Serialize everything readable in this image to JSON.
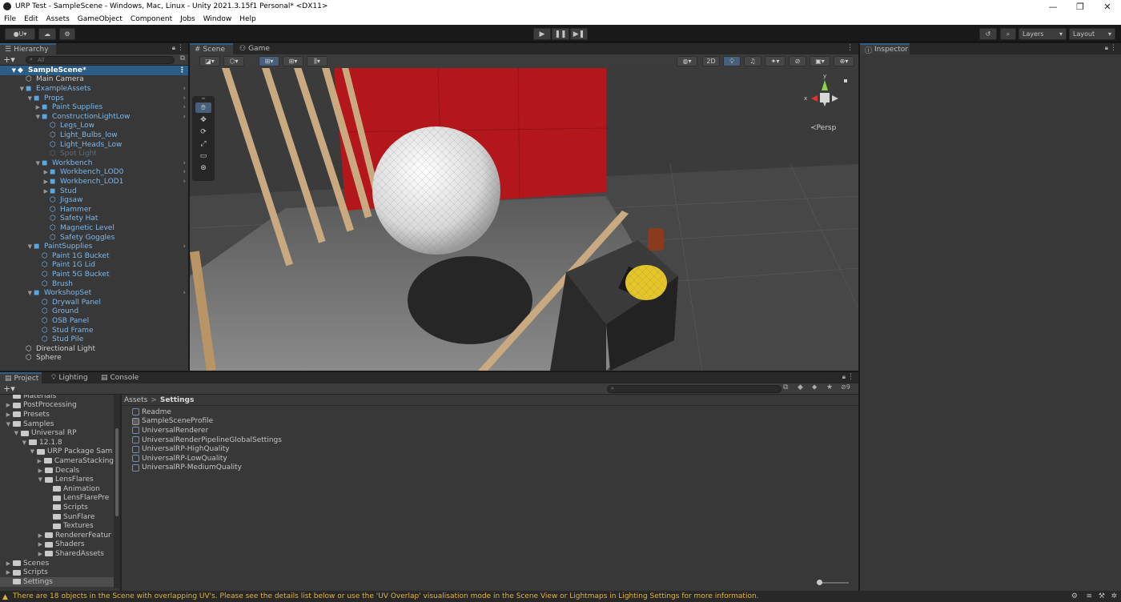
{
  "window": {
    "title": "URP Test - SampleScene - Windows, Mac, Linux - Unity 2021.3.15f1 Personal* <DX11>"
  },
  "menu": [
    "File",
    "Edit",
    "Assets",
    "GameObject",
    "Component",
    "Jobs",
    "Window",
    "Help"
  ],
  "toolbar": {
    "account": "U",
    "layers": "Layers",
    "layout": "Layout"
  },
  "hierarchy": {
    "tab": "Hierarchy",
    "search_placeholder": "All",
    "items": [
      {
        "label": "SampleScene*",
        "depth": 0,
        "arrow": "▼",
        "kind": "scene"
      },
      {
        "label": "Main Camera",
        "depth": 1,
        "arrow": "",
        "kind": "white"
      },
      {
        "label": "ExampleAssets",
        "depth": 1,
        "arrow": "▼",
        "kind": "blue",
        "more": true
      },
      {
        "label": "Props",
        "depth": 2,
        "arrow": "▼",
        "kind": "blue",
        "more": true
      },
      {
        "label": "Paint Supplies",
        "depth": 3,
        "arrow": "▶",
        "kind": "blue",
        "more": true
      },
      {
        "label": "ConstructionLightLow",
        "depth": 3,
        "arrow": "▼",
        "kind": "blue",
        "more": true
      },
      {
        "label": "Legs_Low",
        "depth": 4,
        "arrow": "",
        "kind": "blue"
      },
      {
        "label": "Light_Bulbs_low",
        "depth": 4,
        "arrow": "",
        "kind": "blue"
      },
      {
        "label": "Light_Heads_Low",
        "depth": 4,
        "arrow": "",
        "kind": "blue"
      },
      {
        "label": "Spot Light",
        "depth": 4,
        "arrow": "",
        "kind": "disabled"
      },
      {
        "label": "Workbench",
        "depth": 3,
        "arrow": "▼",
        "kind": "blue",
        "more": true
      },
      {
        "label": "Workbench_LOD0",
        "depth": 4,
        "arrow": "▶",
        "kind": "blue",
        "more": true
      },
      {
        "label": "Workbench_LOD1",
        "depth": 4,
        "arrow": "▶",
        "kind": "blue",
        "more": true
      },
      {
        "label": "Stud",
        "depth": 4,
        "arrow": "▶",
        "kind": "blue"
      },
      {
        "label": "Jigsaw",
        "depth": 4,
        "arrow": "",
        "kind": "blue"
      },
      {
        "label": "Hammer",
        "depth": 4,
        "arrow": "",
        "kind": "blue"
      },
      {
        "label": "Safety Hat",
        "depth": 4,
        "arrow": "",
        "kind": "blue"
      },
      {
        "label": "Magnetic Level",
        "depth": 4,
        "arrow": "",
        "kind": "blue"
      },
      {
        "label": "Safety Goggles",
        "depth": 4,
        "arrow": "",
        "kind": "blue"
      },
      {
        "label": "PaintSupplies",
        "depth": 2,
        "arrow": "▼",
        "kind": "blue",
        "more": true
      },
      {
        "label": "Paint 1G Bucket",
        "depth": 3,
        "arrow": "",
        "kind": "blue"
      },
      {
        "label": "Paint 1G Lid",
        "depth": 3,
        "arrow": "",
        "kind": "blue"
      },
      {
        "label": "Paint 5G Bucket",
        "depth": 3,
        "arrow": "",
        "kind": "blue"
      },
      {
        "label": "Brush",
        "depth": 3,
        "arrow": "",
        "kind": "blue"
      },
      {
        "label": "WorkshopSet",
        "depth": 2,
        "arrow": "▼",
        "kind": "blue",
        "more": true
      },
      {
        "label": "Drywall Panel",
        "depth": 3,
        "arrow": "",
        "kind": "blue"
      },
      {
        "label": "Ground",
        "depth": 3,
        "arrow": "",
        "kind": "blue"
      },
      {
        "label": "OSB Panel",
        "depth": 3,
        "arrow": "",
        "kind": "blue"
      },
      {
        "label": "Stud Frame",
        "depth": 3,
        "arrow": "",
        "kind": "blue"
      },
      {
        "label": "Stud Pile",
        "depth": 3,
        "arrow": "",
        "kind": "blue"
      },
      {
        "label": "Directional Light",
        "depth": 1,
        "arrow": "",
        "kind": "white"
      },
      {
        "label": "Sphere",
        "depth": 1,
        "arrow": "",
        "kind": "white"
      }
    ]
  },
  "scene": {
    "tabs": [
      "Scene",
      "Game"
    ],
    "mode_2d": "2D",
    "projection": "Persp",
    "gizmo_axes": {
      "y": "y",
      "x": "x"
    }
  },
  "inspector": {
    "tab": "Inspector"
  },
  "project": {
    "tabs": [
      "Project",
      "Lighting",
      "Console"
    ],
    "breadcrumb": [
      "Assets",
      "Settings"
    ],
    "hidden_count": "9",
    "tree": [
      {
        "label": "Materials",
        "depth": 1,
        "arrow": ""
      },
      {
        "label": "PostProcessing",
        "depth": 1,
        "arrow": "▶"
      },
      {
        "label": "Presets",
        "depth": 1,
        "arrow": "▶"
      },
      {
        "label": "Samples",
        "depth": 1,
        "arrow": "▼"
      },
      {
        "label": "Universal RP",
        "depth": 2,
        "arrow": "▼"
      },
      {
        "label": "12.1.8",
        "depth": 3,
        "arrow": "▼"
      },
      {
        "label": "URP Package Sam",
        "depth": 4,
        "arrow": "▼"
      },
      {
        "label": "CameraStacking",
        "depth": 5,
        "arrow": "▶"
      },
      {
        "label": "Decals",
        "depth": 5,
        "arrow": "▶"
      },
      {
        "label": "LensFlares",
        "depth": 5,
        "arrow": "▼"
      },
      {
        "label": "Animation",
        "depth": 6,
        "arrow": ""
      },
      {
        "label": "LensFlarePre",
        "depth": 6,
        "arrow": ""
      },
      {
        "label": "Scripts",
        "depth": 6,
        "arrow": ""
      },
      {
        "label": "SunFlare",
        "depth": 6,
        "arrow": ""
      },
      {
        "label": "Textures",
        "depth": 6,
        "arrow": ""
      },
      {
        "label": "RendererFeatur",
        "depth": 5,
        "arrow": "▶"
      },
      {
        "label": "Shaders",
        "depth": 5,
        "arrow": "▶"
      },
      {
        "label": "SharedAssets",
        "depth": 5,
        "arrow": "▶"
      },
      {
        "label": "Scenes",
        "depth": 1,
        "arrow": "▶"
      },
      {
        "label": "Scripts",
        "depth": 1,
        "arrow": "▶"
      },
      {
        "label": "Settings",
        "depth": 1,
        "arrow": "",
        "selected": true
      }
    ],
    "assets": [
      "Readme",
      "SampleSceneProfile",
      "UniversalRenderer",
      "UniversalRenderPipelineGlobalSettings",
      "UniversalRP-HighQuality",
      "UniversalRP-LowQuality",
      "UniversalRP-MediumQuality"
    ]
  },
  "status": {
    "message": "There are 18 objects in the Scene with overlapping UV's. Please see the details list below or use the 'UV Overlap' visualisation mode in the Scene View or Lightmaps in Lighting Settings for more information."
  },
  "colors": {
    "accent": "#2c5d87",
    "warning": "#e1b33b",
    "wall": "#b3171c"
  }
}
